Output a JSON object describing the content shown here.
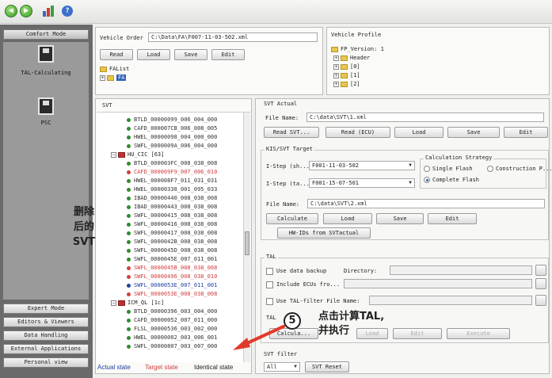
{
  "toolbar": {
    "icons": [
      "back-icon",
      "forward-icon",
      "tools-icon",
      "help-icon"
    ]
  },
  "sidebar": {
    "top_button": "Comfort Mode",
    "items": [
      {
        "label": "TAL-Calculating",
        "icon": "disk-icon"
      },
      {
        "label": "PSC",
        "icon": "disk-icon"
      }
    ],
    "bottom_buttons": [
      "Expert Mode",
      "Editors & Viewers",
      "Data Handling",
      "External Applications",
      "Personal view"
    ]
  },
  "vehicle_order": {
    "label": "Vehicle Order",
    "path": "C:\\Data\\FA\\F007-11-03-502.xml",
    "buttons": [
      "Read",
      "Load",
      "Save",
      "Edit"
    ],
    "tree": {
      "root": "FAList",
      "child": "FA"
    }
  },
  "vehicle_profile": {
    "title": "Vehicle Profile",
    "root": "FP_Version: 1",
    "items": [
      "Header",
      "[0]",
      "[1]",
      "[2]"
    ]
  },
  "svt": {
    "title": "SVT",
    "rows": [
      {
        "indent": 2,
        "text": "BTLD_00000099_006_004_000",
        "color": "#333",
        "dot": "#2e8b2e"
      },
      {
        "indent": 2,
        "text": "CAFD_000007CB_006_008_005",
        "color": "#333",
        "dot": "#2e8b2e"
      },
      {
        "indent": 2,
        "text": "HWEL_00000098_004_000_000",
        "color": "#333",
        "dot": "#2e8b2e"
      },
      {
        "indent": 2,
        "text": "SWFL_0000009A_006_004_000",
        "color": "#333",
        "dot": "#2e8b2e"
      },
      {
        "indent": 1,
        "text": "HU_CIC [63]",
        "color": "#222",
        "node": true
      },
      {
        "indent": 2,
        "text": "BTLD_000003FC_008_038_008",
        "color": "#333",
        "dot": "#2e8b2e"
      },
      {
        "indent": 2,
        "text": "CAFD_000009F9_007_006_010",
        "color": "#d04040",
        "dot": "#d04040"
      },
      {
        "indent": 2,
        "text": "HWEL_000008F7_011_031_031",
        "color": "#333",
        "dot": "#2e8b2e"
      },
      {
        "indent": 2,
        "text": "HWEL_00000338_001_095_033",
        "color": "#333",
        "dot": "#2e8b2e"
      },
      {
        "indent": 2,
        "text": "IBAD_00000440_008_038_008",
        "color": "#333",
        "dot": "#2e8b2e"
      },
      {
        "indent": 2,
        "text": "IBAD_00000443_008_038_008",
        "color": "#333",
        "dot": "#2e8b2e"
      },
      {
        "indent": 2,
        "text": "SWFL_00000415_008_038_008",
        "color": "#333",
        "dot": "#2e8b2e"
      },
      {
        "indent": 2,
        "text": "SWFL_00000416_008_038_008",
        "color": "#333",
        "dot": "#2e8b2e"
      },
      {
        "indent": 2,
        "text": "SWFL_00000417_008_038_008",
        "color": "#333",
        "dot": "#2e8b2e"
      },
      {
        "indent": 2,
        "text": "SWFL_0000042B_008_038_008",
        "color": "#333",
        "dot": "#2e8b2e"
      },
      {
        "indent": 2,
        "text": "SWFL_0000045D_008_038_008",
        "color": "#333",
        "dot": "#2e8b2e"
      },
      {
        "indent": 2,
        "text": "SWFL_0000045E_007_011_001",
        "color": "#333",
        "dot": "#2e8b2e"
      },
      {
        "indent": 2,
        "text": "SWFL_0000045B_008_038_008",
        "color": "#d04040",
        "dot": "#d04040"
      },
      {
        "indent": 2,
        "text": "SWFL_00000496_008_038_010",
        "color": "#d04040",
        "dot": "#d04040"
      },
      {
        "indent": 2,
        "text": "SWFL_0000053E_007_011_001",
        "color": "#2040a0",
        "dot": "#2040a0"
      },
      {
        "indent": 2,
        "text": "SWFL_0000053E_008_038_008",
        "color": "#d04040",
        "dot": "#d04040"
      },
      {
        "indent": 1,
        "text": "ICM_QL [1c]",
        "color": "#222",
        "node": true
      },
      {
        "indent": 2,
        "text": "BTLD_00000396_003_004_000",
        "color": "#333",
        "dot": "#2e8b2e"
      },
      {
        "indent": 2,
        "text": "CAFD_00000052_007_011_000",
        "color": "#333",
        "dot": "#2e8b2e"
      },
      {
        "indent": 2,
        "text": "FLSL_00000536_003_002_000",
        "color": "#333",
        "dot": "#2e8b2e"
      },
      {
        "indent": 2,
        "text": "HWEL_00000002_003_006_001",
        "color": "#333",
        "dot": "#2e8b2e"
      },
      {
        "indent": 2,
        "text": "SWFL_00000807_003_007_000",
        "color": "#333",
        "dot": "#2e8b2e"
      }
    ],
    "legend": {
      "actual": "Actual state",
      "target": "Target state",
      "identical": "Identical state"
    }
  },
  "annotation_left": {
    "line1": "删除",
    "line2": "后的",
    "line3": "SVT"
  },
  "svt_actual": {
    "title": "SVT Actual",
    "file_label": "File Name:",
    "file_value": "C:\\data\\SVT\\1.xml",
    "buttons": [
      "Read SVT...",
      "Read (ECU)",
      "Load",
      "Save",
      "Edit"
    ]
  },
  "kis_target": {
    "title": "KIS/SVT Target",
    "istep1_label": "I-Step (sh...",
    "istep1_value": "F001-11-03-502",
    "istep2_label": "I-Step (ta...",
    "istep2_value": "F001-15-07-501",
    "strategy": {
      "title": "Calculation Strategy",
      "single": "Single Flash",
      "construction": "Construction P...",
      "complete": "Complete Flash"
    },
    "file_label": "File Name:",
    "file_value": "C:\\data\\SVT\\2.xml",
    "buttons": [
      "Calculate",
      "Load",
      "Save",
      "Edit"
    ],
    "hw_button": "HW-IDs from SVTactual"
  },
  "tal": {
    "title": "TAL",
    "backup_label": "Use data backup",
    "directory_label": "Directory:",
    "include_label": "Include ECUs fro...",
    "filter_label": "Use TAL-filter File Name:",
    "tal_label": "TAL",
    "buttons": [
      "Calcula...",
      "Load",
      "Edit",
      "Execute"
    ]
  },
  "annotation_step": {
    "number": "5",
    "line1": "点击计算TAL,",
    "line2": "并执行"
  },
  "svt_filter": {
    "title": "SVT filter",
    "select": "All",
    "reset": "SVT Reset"
  }
}
